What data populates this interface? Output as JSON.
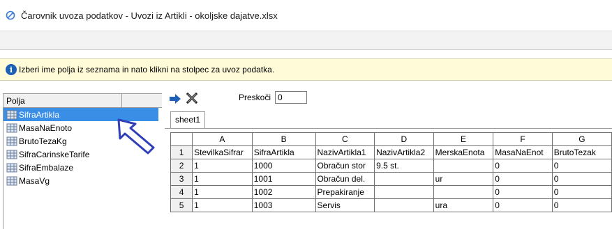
{
  "window": {
    "title": "Čarovnik uvoza podatkov - Uvozi iz Artikli - okoljske dajatve.xlsx",
    "app_icon": "wizard-icon"
  },
  "info": {
    "icon": "info-icon",
    "text": "Izberi ime polja iz seznama in nato klikni na stolpec za uvoz podatka."
  },
  "fields_panel": {
    "header": "Polja",
    "items": [
      {
        "label": "SifraArtikla",
        "selected": true
      },
      {
        "label": "MasaNaEnoto",
        "selected": false
      },
      {
        "label": "BrutoTezaKg",
        "selected": false
      },
      {
        "label": "SifraCarinskeTarife",
        "selected": false
      },
      {
        "label": "SifraEmbalaze",
        "selected": false
      },
      {
        "label": "MasaVg",
        "selected": false
      }
    ]
  },
  "toolbar": {
    "import_icon": "arrow-right-icon",
    "clear_icon": "delete-x-icon",
    "skip_label": "Preskoči",
    "skip_value": "0"
  },
  "sheet_tab": "sheet1",
  "grid": {
    "columns": [
      "A",
      "B",
      "C",
      "D",
      "E",
      "F",
      "G"
    ],
    "rows": [
      {
        "num": "1",
        "cells": [
          "StevilkaSifrar",
          "SifraArtikla",
          "NazivArtikla1",
          "NazivArtikla2",
          "MerskaEnota",
          "MasaNaEnot",
          "BrutoTezak"
        ]
      },
      {
        "num": "2",
        "cells": [
          "1",
          "1000",
          "Obračun stor",
          "9.5 st.",
          "",
          "0",
          "0"
        ]
      },
      {
        "num": "3",
        "cells": [
          "1",
          "1001",
          "Obračun del.",
          "",
          "ur",
          "0",
          "0"
        ]
      },
      {
        "num": "4",
        "cells": [
          "1",
          "1002",
          "Prepakiranje",
          "",
          "",
          "0",
          "0"
        ]
      },
      {
        "num": "5",
        "cells": [
          "1",
          "1003",
          "Servis",
          "",
          "ura",
          "0",
          "0"
        ]
      }
    ]
  },
  "colors": {
    "selection": "#3a8ee6",
    "info_background": "#fffbd8",
    "arrow_blue": "#1e5fb8"
  }
}
